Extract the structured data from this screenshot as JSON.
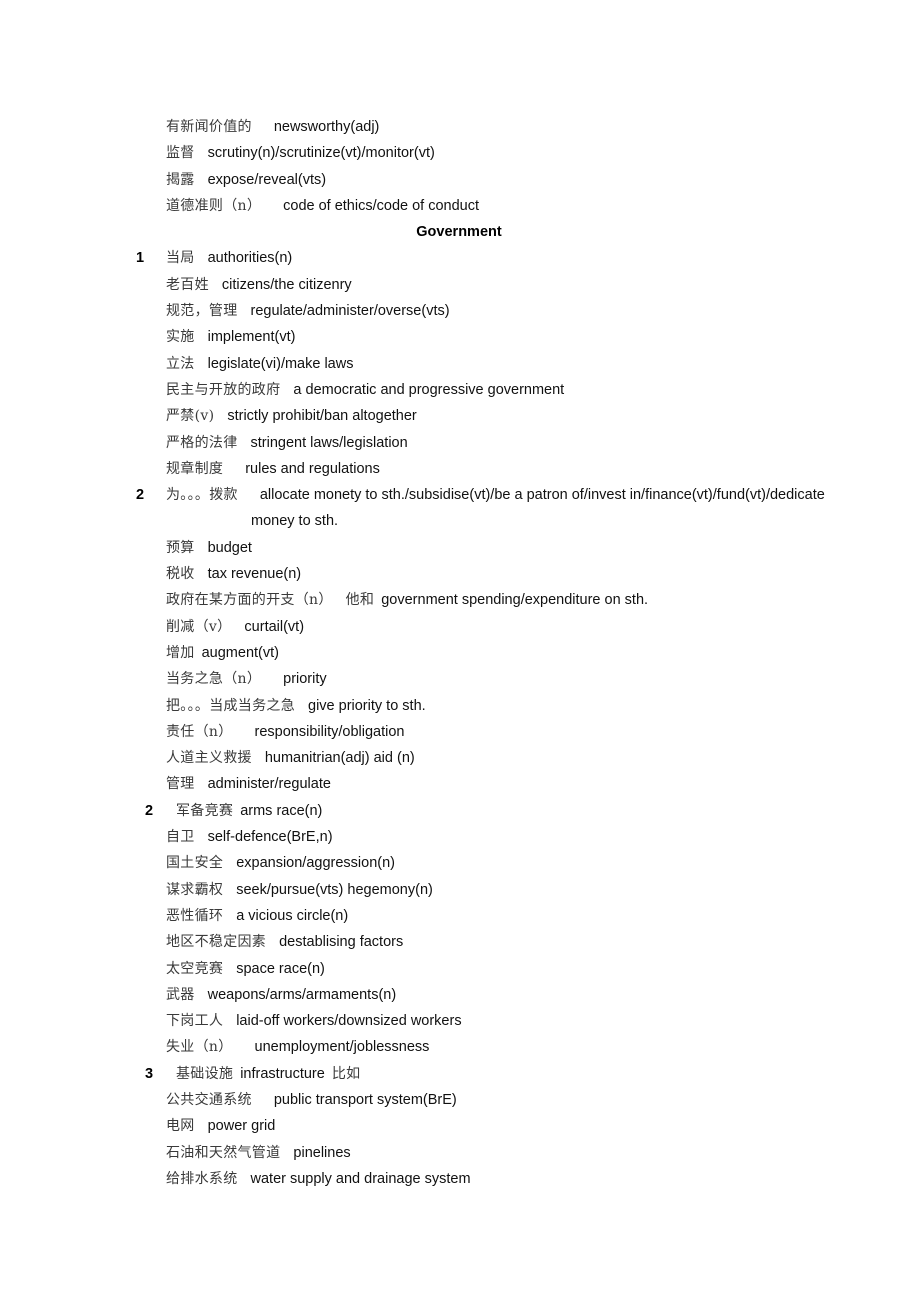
{
  "document": {
    "section_heading": "Government",
    "entries": [
      {
        "id": "newsworthy",
        "marker": "",
        "level": 1,
        "cn": "有新闻价值的",
        "gap": "lg",
        "en": "newsworthy(adj)"
      },
      {
        "id": "scrutiny",
        "marker": "",
        "level": 1,
        "cn": "监督",
        "gap": "md",
        "en": "scrutiny(n)/scrutinize(vt)/monitor(vt)"
      },
      {
        "id": "expose",
        "marker": "",
        "level": 1,
        "cn": "揭露",
        "gap": "md",
        "en": "expose/reveal(vts)"
      },
      {
        "id": "ethics",
        "marker": "",
        "level": 1,
        "cn": "道德准则（n）",
        "gap": "lg",
        "en": "code of ethics/code of conduct"
      },
      {
        "id": "authorities",
        "marker": "1",
        "markerLevel": "a",
        "level": 2,
        "cn": "当局",
        "gap": "md",
        "en": "authorities(n)"
      },
      {
        "id": "citizens",
        "marker": "",
        "level": 1,
        "cn": "老百姓",
        "gap": "md",
        "en": "citizens/the citizenry"
      },
      {
        "id": "regulate",
        "marker": "",
        "level": 1,
        "cn": "规范，管理",
        "gap": "md",
        "en": "regulate/administer/overse(vts)"
      },
      {
        "id": "implement",
        "marker": "",
        "level": 1,
        "cn": "实施",
        "gap": "md",
        "en": "implement(vt)"
      },
      {
        "id": "legislate",
        "marker": "",
        "level": 1,
        "cn": "立法",
        "gap": "md",
        "en": "legislate(vi)/make laws"
      },
      {
        "id": "democratic",
        "marker": "",
        "level": 1,
        "cn": "民主与开放的政府",
        "gap": "md",
        "en": "a democratic and progressive government"
      },
      {
        "id": "prohibit",
        "marker": "",
        "level": 1,
        "cn": "严禁(v)",
        "gap": "md",
        "en": "strictly prohibit/ban altogether"
      },
      {
        "id": "stringent",
        "marker": "",
        "level": 1,
        "cn": "严格的法律",
        "gap": "md",
        "en": "stringent laws/legislation"
      },
      {
        "id": "rules",
        "marker": "",
        "level": 1,
        "cn": "规章制度",
        "gap": "lg",
        "en": "rules and regulations"
      },
      {
        "id": "allocate",
        "marker": "2",
        "markerLevel": "a",
        "level": 2,
        "cn": "为。。。拨款",
        "gap": "lg",
        "en": "allocate monety to sth./subsidise(vt)/be a patron of/invest in/finance(vt)/fund(vt)/dedicate",
        "wrap": "money to sth."
      },
      {
        "id": "budget",
        "marker": "",
        "level": 1,
        "cn": "预算",
        "gap": "md",
        "en": "budget"
      },
      {
        "id": "taxrevenue",
        "marker": "",
        "level": 1,
        "cn": "税收",
        "gap": "md",
        "en": "tax revenue(n)"
      },
      {
        "id": "spending",
        "marker": "",
        "level": 1,
        "cn": "政府在某方面的开支（n）",
        "gap": "md",
        "cn2": "他和",
        "en": "government spending/expenditure on sth."
      },
      {
        "id": "curtail",
        "marker": "",
        "level": 1,
        "cn": "削减（v）",
        "gap": "md",
        "en": "curtail(vt)"
      },
      {
        "id": "augment",
        "marker": "",
        "level": 1,
        "cn": "增加",
        "gap": "sm",
        "en": "augment(vt)"
      },
      {
        "id": "priority",
        "marker": "",
        "level": 1,
        "cn": "当务之急（n）",
        "gap": "lg",
        "en": "priority"
      },
      {
        "id": "givepriority",
        "marker": "",
        "level": 1,
        "cn": "把。。。当成当务之急",
        "gap": "md",
        "en": "give priority to sth."
      },
      {
        "id": "responsibility",
        "marker": "",
        "level": 1,
        "cn": "责任（n）",
        "gap": "lg",
        "en": "responsibility/obligation"
      },
      {
        "id": "humanitarian",
        "marker": "",
        "level": 1,
        "cn": "人道主义救援",
        "gap": "md",
        "en": "humanitrian(adj) aid (n)"
      },
      {
        "id": "administer",
        "marker": "",
        "level": 1,
        "cn": "管理",
        "gap": "md",
        "en": "administer/regulate"
      },
      {
        "id": "armsrace",
        "marker": "2",
        "markerLevel": "b",
        "level": 3,
        "cn": "军备竞赛",
        "gap": "sm",
        "en": "arms race(n)"
      },
      {
        "id": "selfdefence",
        "marker": "",
        "level": 1,
        "cn": "自卫",
        "gap": "md",
        "en": "self-defence(BrE,n)"
      },
      {
        "id": "homeland",
        "marker": "",
        "level": 1,
        "cn": "国土安全",
        "gap": "md",
        "en": "expansion/aggression(n)"
      },
      {
        "id": "hegemony",
        "marker": "",
        "level": 1,
        "cn": "谋求霸权",
        "gap": "md",
        "en": "seek/pursue(vts) hegemony(n)"
      },
      {
        "id": "viciouscircle",
        "marker": "",
        "level": 1,
        "cn": "恶性循环",
        "gap": "md",
        "en": "a vicious circle(n)"
      },
      {
        "id": "destabilising",
        "marker": "",
        "level": 1,
        "cn": "地区不稳定因素",
        "gap": "md",
        "en": "destablising factors"
      },
      {
        "id": "spacerace",
        "marker": "",
        "level": 1,
        "cn": "太空竞赛",
        "gap": "md",
        "en": "space race(n)"
      },
      {
        "id": "weapons",
        "marker": "",
        "level": 1,
        "cn": "武器",
        "gap": "md",
        "en": "weapons/arms/armaments(n)"
      },
      {
        "id": "laidoff",
        "marker": "",
        "level": 1,
        "cn": "下岗工人",
        "gap": "md",
        "en": "laid-off workers/downsized workers"
      },
      {
        "id": "unemployment",
        "marker": "",
        "level": 1,
        "cn": "失业（n）",
        "gap": "lg",
        "en": "unemployment/joblessness"
      },
      {
        "id": "infrastructure",
        "marker": "3",
        "markerLevel": "b",
        "level": 3,
        "cn": "基础设施",
        "gap": "sm",
        "en": "infrastructure",
        "cn_tail": "比如"
      },
      {
        "id": "transport",
        "marker": "",
        "level": 1,
        "cn": "公共交通系统",
        "gap": "lg",
        "en": "public transport system(BrE)"
      },
      {
        "id": "powergrid",
        "marker": "",
        "level": 1,
        "cn": "电网",
        "gap": "md",
        "en": "power grid"
      },
      {
        "id": "pipelines",
        "marker": "",
        "level": 1,
        "cn": "石油和天然气管道",
        "gap": "md",
        "en": "pinelines"
      },
      {
        "id": "watersupply",
        "marker": "",
        "level": 1,
        "cn": "给排水系统",
        "gap": "md",
        "en": "water supply and drainage system"
      }
    ]
  },
  "colors": {
    "page_background": "#ffffff",
    "english_text": "#111111",
    "chinese_text": "#3a3a3a",
    "marker_text": "#000000"
  }
}
